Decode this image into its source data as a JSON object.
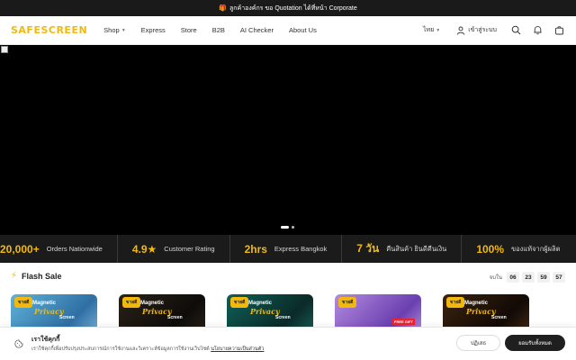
{
  "announcement": {
    "icon": "gift-icon",
    "text": "ลูกค้าองค์กร ขอ Quotation ได้ที่หน้า Corporate"
  },
  "nav": {
    "logo": "SAFESCREEN",
    "menu": [
      {
        "label": "Shop",
        "has_dropdown": true
      },
      {
        "label": "Express"
      },
      {
        "label": "Store"
      },
      {
        "label": "B2B"
      },
      {
        "label": "AI Checker"
      },
      {
        "label": "About Us"
      }
    ],
    "language": "ไทย",
    "login_label": "เข้าสู่ระบบ",
    "icons": [
      "user-icon",
      "search-icon",
      "bell-icon",
      "cart-icon"
    ]
  },
  "hero": {
    "slide_count": 2,
    "active_slide": 1
  },
  "stats": [
    {
      "number": "20,000+",
      "label": "Orders Nationwide"
    },
    {
      "number": "4.9★",
      "label": "Customer Rating"
    },
    {
      "number": "2hrs",
      "label": "Express Bangkok"
    },
    {
      "number": "7 วัน",
      "label": "คืนสินค้า ยินดีคืนเงิน"
    },
    {
      "number": "100%",
      "label": "ของแท้จากผู้ผลิต"
    }
  ],
  "flash_sale": {
    "title": "Flash Sale",
    "timer_label": "จบใน",
    "timer": [
      "06",
      "23",
      "59",
      "57"
    ],
    "cards": [
      {
        "tag": "ขายดี",
        "line1": "Magnetic",
        "line2": "Privacy",
        "line3": "Screen"
      },
      {
        "tag": "ขายดี",
        "line1": "Magnetic",
        "line2": "Privacy",
        "line3": "Screen"
      },
      {
        "tag": "ขายดี",
        "line1": "Magnetic",
        "line2": "Privacy",
        "line3": "Screen"
      },
      {
        "tag": "ขายดี",
        "badge": "FREE GIFT"
      },
      {
        "tag": "ขายดี",
        "line1": "Magnetic",
        "line2": "Privacy",
        "line3": "Screen"
      }
    ]
  },
  "cookie": {
    "title": "เราใช้คุกกี้",
    "text": "เราใช้คุกกี้เพื่อปรับปรุงประสบการณ์การใช้งานและวิเคราะห์ข้อมูลการใช้งานเว็บไซต์",
    "link": "นโยบายความเป็นส่วนตัว",
    "decline": "ปฏิเสธ",
    "accept": "ยอมรับทั้งหมด"
  }
}
